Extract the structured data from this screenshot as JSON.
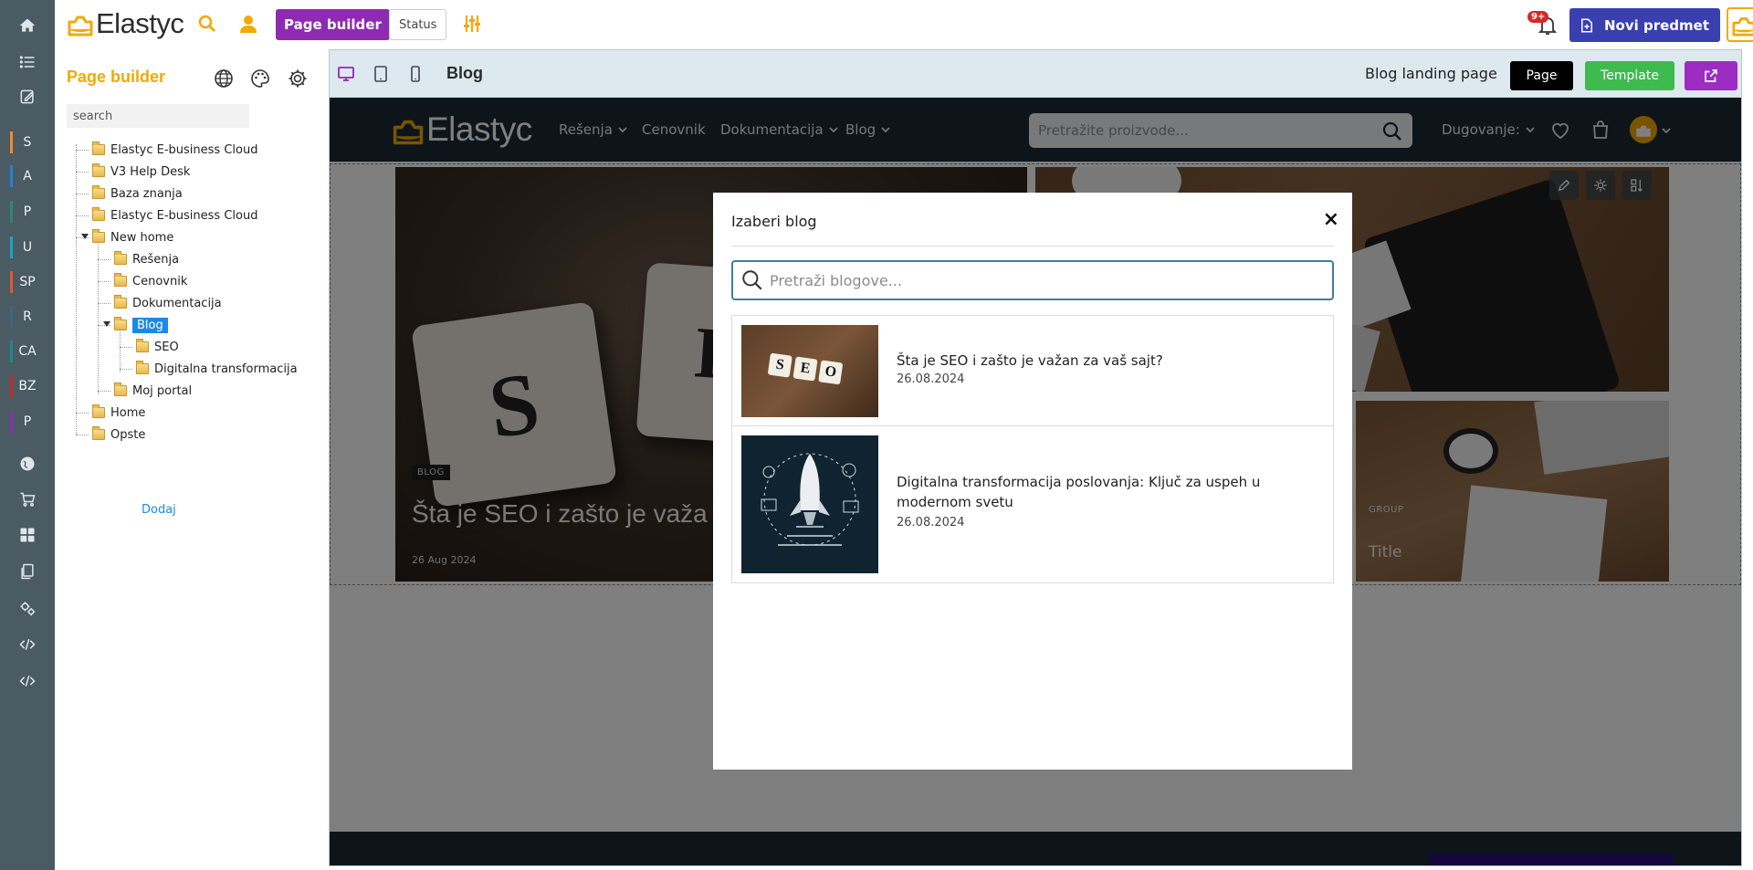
{
  "app": {
    "logo_text": "Elastyc",
    "page_builder_button": "Page builder",
    "status_button": "Status",
    "notification_badge": "9+",
    "new_item_button": "Novi predmet",
    "brand_color": "#f2a900",
    "accent_purple": "#8e2bb2"
  },
  "rail": {
    "letters": [
      {
        "label": "S",
        "color": "#f28c28"
      },
      {
        "label": "A",
        "color": "#2a7fd4"
      },
      {
        "label": "P",
        "color": "#2a8a6a"
      },
      {
        "label": "U",
        "color": "#1aa3c4"
      },
      {
        "label": "SP",
        "color": "#e05a2a"
      },
      {
        "label": "R",
        "color": "#3a6a7a"
      },
      {
        "label": "CA",
        "color": "#1a8a8a"
      },
      {
        "label": "BZ",
        "color": "#c62828"
      },
      {
        "label": "P",
        "color": "#8e2bb2"
      }
    ]
  },
  "panel": {
    "title": "Page builder",
    "search_placeholder": "search",
    "tree": [
      {
        "label": "Elastyc E-business Cloud",
        "level": 0
      },
      {
        "label": "V3 Help Desk",
        "level": 0
      },
      {
        "label": "Baza znanja",
        "level": 0
      },
      {
        "label": "Elastyc E-business Cloud",
        "level": 0
      },
      {
        "label": "New home",
        "level": 0,
        "expanded": true
      },
      {
        "label": "Rešenja",
        "level": 1
      },
      {
        "label": "Cenovnik",
        "level": 1
      },
      {
        "label": "Dokumentacija",
        "level": 1
      },
      {
        "label": "Blog",
        "level": 1,
        "expanded": true,
        "selected": true
      },
      {
        "label": "SEO",
        "level": 2
      },
      {
        "label": "Digitalna transformacija",
        "level": 2
      },
      {
        "label": "Moj portal",
        "level": 1
      },
      {
        "label": "Home",
        "level": 0
      },
      {
        "label": "Opste",
        "level": 0
      }
    ],
    "add_link": "Dodaj"
  },
  "editor": {
    "page_title": "Blog",
    "landing_label": "Blog landing page",
    "page_button": "Page",
    "template_button": "Template"
  },
  "site": {
    "logo_text": "Elastyc",
    "nav": [
      {
        "label": "Rešenja",
        "dropdown": true
      },
      {
        "label": "Cenovnik",
        "dropdown": false
      },
      {
        "label": "Dokumentacija",
        "dropdown": true
      },
      {
        "label": "Blog",
        "dropdown": true
      }
    ],
    "search_placeholder": "Pretražite proizvode...",
    "debt_label": "Dugovanje:",
    "hero": {
      "tag": "BLOG",
      "title": "Šta je SEO i zašto je važa",
      "date": "26 Aug 2024",
      "tile_letters": [
        "S",
        "E"
      ]
    },
    "side_card": {
      "tag": "GROUP",
      "title": "Title"
    }
  },
  "modal": {
    "title": "Izaberi blog",
    "close_symbol": "×",
    "search_placeholder": "Pretraži blogove...",
    "results": [
      {
        "title": "Šta je SEO i zašto je važan za vaš sajt?",
        "date": "26.08.2024",
        "thumb_letters": "SEO"
      },
      {
        "title": "Digitalna transformacija poslovanja: Ključ za uspeh u modernom svetu",
        "date": "26.08.2024"
      }
    ]
  }
}
